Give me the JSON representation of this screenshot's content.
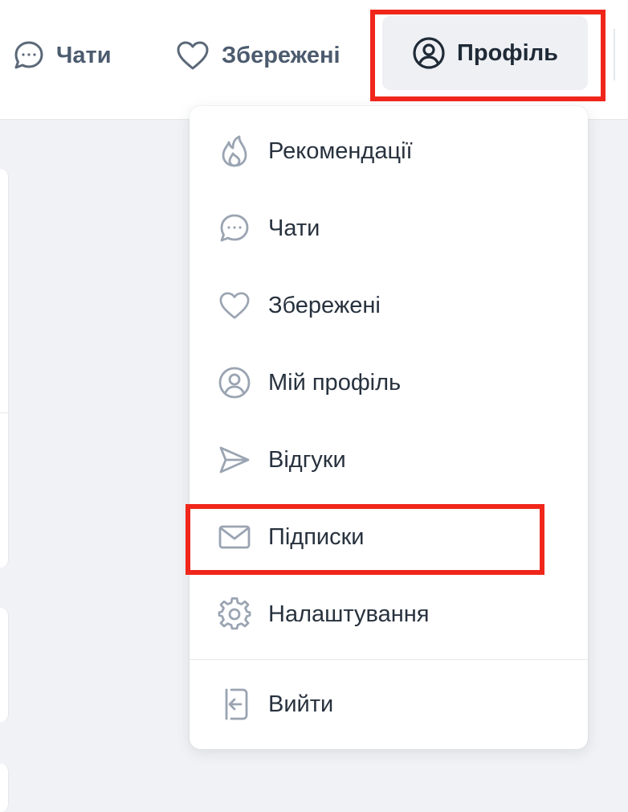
{
  "topnav": {
    "chats_label": "Чати",
    "saved_label": "Збережені",
    "profile_label": "Профіль"
  },
  "menu": {
    "items": [
      {
        "label": "Рекомендації",
        "icon": "flame-icon"
      },
      {
        "label": "Чати",
        "icon": "chat-bubble-icon"
      },
      {
        "label": "Збережені",
        "icon": "heart-icon"
      },
      {
        "label": "Мій профіль",
        "icon": "user-circle-icon"
      },
      {
        "label": "Відгуки",
        "icon": "send-icon"
      },
      {
        "label": "Підписки",
        "icon": "mail-icon"
      },
      {
        "label": "Налаштування",
        "icon": "gear-icon"
      },
      {
        "label": "Вийти",
        "icon": "logout-icon"
      }
    ]
  },
  "colors": {
    "highlight": "#f0261b",
    "icon_gray": "#9aa4b2",
    "text_dark": "#28323e",
    "nav_text": "#4c5b6e"
  }
}
